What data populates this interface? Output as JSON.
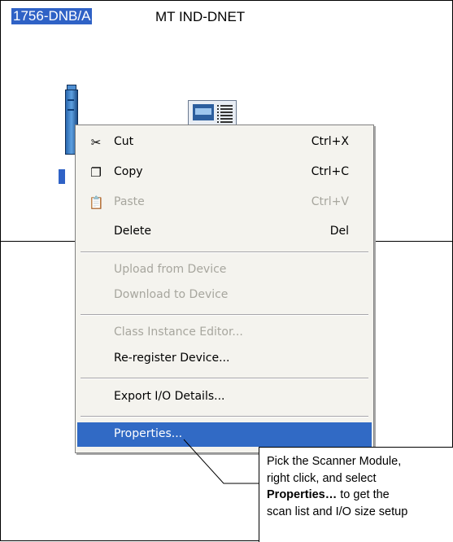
{
  "network": {
    "node_1_label": "1756-DNB/A",
    "node_2_label": "MT IND-DNET"
  },
  "context_menu": {
    "items": [
      {
        "label": "Cut",
        "shortcut": "Ctrl+X",
        "icon": "scissors-icon",
        "enabled": true
      },
      {
        "label": "Copy",
        "shortcut": "Ctrl+C",
        "icon": "copy-icon",
        "enabled": true
      },
      {
        "label": "Paste",
        "shortcut": "Ctrl+V",
        "icon": "paste-icon",
        "enabled": false
      },
      {
        "label": "Delete",
        "shortcut": "Del",
        "enabled": true
      },
      {
        "label": "Upload from Device",
        "enabled": false
      },
      {
        "label": "Download to Device",
        "enabled": false
      },
      {
        "label": "Class Instance Editor...",
        "enabled": false
      },
      {
        "label": "Re-register Device...",
        "enabled": true
      },
      {
        "label": "Export I/O Details...",
        "enabled": true
      },
      {
        "label": "Properties...",
        "enabled": true,
        "highlighted": true
      }
    ]
  },
  "callout": {
    "line1": "Pick the Scanner Module,",
    "line2": "right click, and select",
    "line3_bold": "Properties…",
    "line3_rest": " to get the",
    "line4": "scan list and I/O size setup"
  },
  "colors": {
    "highlight": "#316ac5",
    "menu_bg": "#f4f3ee",
    "disabled_text": "#a7a69e"
  }
}
